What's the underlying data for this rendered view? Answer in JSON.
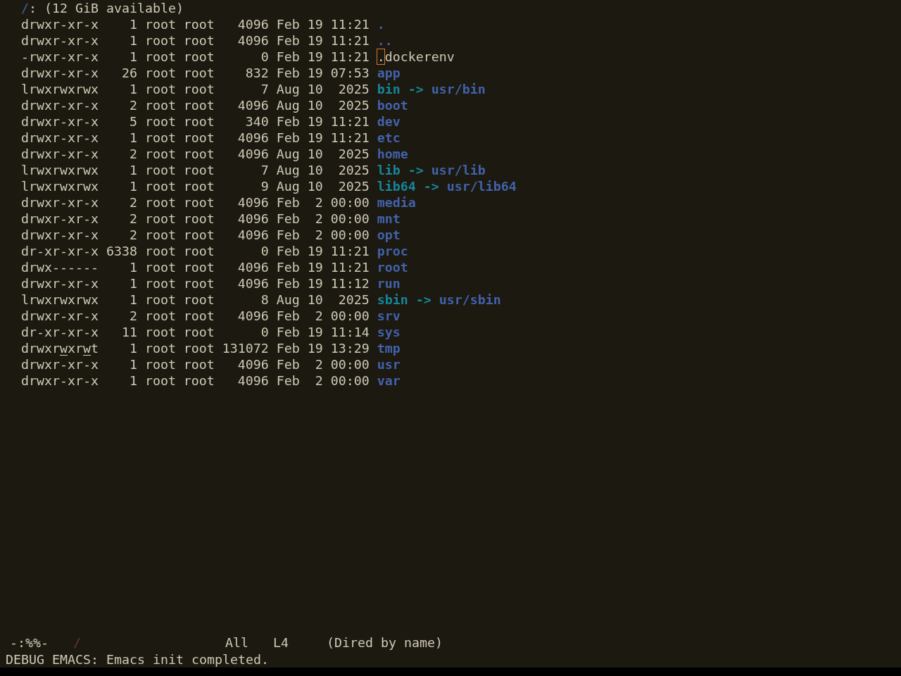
{
  "header": {
    "path": "/",
    "summary": ": (12 GiB available)"
  },
  "rows": [
    {
      "kind": "dir",
      "perms": "drwxr-xr-x",
      "world_writable": false,
      "links": "1",
      "owner": "root",
      "group": "root",
      "size": "4096",
      "date": "Feb 19 11:21",
      "name": ".",
      "cursor": false
    },
    {
      "kind": "dir",
      "perms": "drwxr-xr-x",
      "world_writable": false,
      "links": "1",
      "owner": "root",
      "group": "root",
      "size": "4096",
      "date": "Feb 19 11:21",
      "name": "..",
      "cursor": false
    },
    {
      "kind": "file",
      "perms": "-rwxr-xr-x",
      "world_writable": false,
      "links": "1",
      "owner": "root",
      "group": "root",
      "size": "0",
      "date": "Feb 19 11:21",
      "name": ".dockerenv",
      "cursor": true
    },
    {
      "kind": "dir",
      "perms": "drwxr-xr-x",
      "world_writable": false,
      "links": "26",
      "owner": "root",
      "group": "root",
      "size": "832",
      "date": "Feb 19 07:53",
      "name": "app",
      "cursor": false
    },
    {
      "kind": "symlink",
      "perms": "lrwxrwxrwx",
      "world_writable": false,
      "links": "1",
      "owner": "root",
      "group": "root",
      "size": "7",
      "date": "Aug 10  2025",
      "name": "bin",
      "arrow": "->",
      "target": "usr/bin",
      "cursor": false
    },
    {
      "kind": "dir",
      "perms": "drwxr-xr-x",
      "world_writable": false,
      "links": "2",
      "owner": "root",
      "group": "root",
      "size": "4096",
      "date": "Aug 10  2025",
      "name": "boot",
      "cursor": false
    },
    {
      "kind": "dir",
      "perms": "drwxr-xr-x",
      "world_writable": false,
      "links": "5",
      "owner": "root",
      "group": "root",
      "size": "340",
      "date": "Feb 19 11:21",
      "name": "dev",
      "cursor": false
    },
    {
      "kind": "dir",
      "perms": "drwxr-xr-x",
      "world_writable": false,
      "links": "1",
      "owner": "root",
      "group": "root",
      "size": "4096",
      "date": "Feb 19 11:21",
      "name": "etc",
      "cursor": false
    },
    {
      "kind": "dir",
      "perms": "drwxr-xr-x",
      "world_writable": false,
      "links": "2",
      "owner": "root",
      "group": "root",
      "size": "4096",
      "date": "Aug 10  2025",
      "name": "home",
      "cursor": false
    },
    {
      "kind": "symlink",
      "perms": "lrwxrwxrwx",
      "world_writable": false,
      "links": "1",
      "owner": "root",
      "group": "root",
      "size": "7",
      "date": "Aug 10  2025",
      "name": "lib",
      "arrow": "->",
      "target": "usr/lib",
      "cursor": false
    },
    {
      "kind": "symlink",
      "perms": "lrwxrwxrwx",
      "world_writable": false,
      "links": "1",
      "owner": "root",
      "group": "root",
      "size": "9",
      "date": "Aug 10  2025",
      "name": "lib64",
      "arrow": "->",
      "target": "usr/lib64",
      "cursor": false
    },
    {
      "kind": "dir",
      "perms": "drwxr-xr-x",
      "world_writable": false,
      "links": "2",
      "owner": "root",
      "group": "root",
      "size": "4096",
      "date": "Feb  2 00:00",
      "name": "media",
      "cursor": false
    },
    {
      "kind": "dir",
      "perms": "drwxr-xr-x",
      "world_writable": false,
      "links": "2",
      "owner": "root",
      "group": "root",
      "size": "4096",
      "date": "Feb  2 00:00",
      "name": "mnt",
      "cursor": false
    },
    {
      "kind": "dir",
      "perms": "drwxr-xr-x",
      "world_writable": false,
      "links": "2",
      "owner": "root",
      "group": "root",
      "size": "4096",
      "date": "Feb  2 00:00",
      "name": "opt",
      "cursor": false
    },
    {
      "kind": "dir",
      "perms": "dr-xr-xr-x",
      "world_writable": false,
      "links": "6338",
      "owner": "root",
      "group": "root",
      "size": "0",
      "date": "Feb 19 11:21",
      "name": "proc",
      "cursor": false
    },
    {
      "kind": "dir",
      "perms": "drwx------",
      "world_writable": false,
      "links": "1",
      "owner": "root",
      "group": "root",
      "size": "4096",
      "date": "Feb 19 11:21",
      "name": "root",
      "cursor": false
    },
    {
      "kind": "dir",
      "perms": "drwxr-xr-x",
      "world_writable": false,
      "links": "1",
      "owner": "root",
      "group": "root",
      "size": "4096",
      "date": "Feb 19 11:12",
      "name": "run",
      "cursor": false
    },
    {
      "kind": "symlink",
      "perms": "lrwxrwxrwx",
      "world_writable": false,
      "links": "1",
      "owner": "root",
      "group": "root",
      "size": "8",
      "date": "Aug 10  2025",
      "name": "sbin",
      "arrow": "->",
      "target": "usr/sbin",
      "cursor": false
    },
    {
      "kind": "dir",
      "perms": "drwxr-xr-x",
      "world_writable": false,
      "links": "2",
      "owner": "root",
      "group": "root",
      "size": "4096",
      "date": "Feb  2 00:00",
      "name": "srv",
      "cursor": false
    },
    {
      "kind": "dir",
      "perms": "dr-xr-xr-x",
      "world_writable": false,
      "links": "11",
      "owner": "root",
      "group": "root",
      "size": "0",
      "date": "Feb 19 11:14",
      "name": "sys",
      "cursor": false
    },
    {
      "kind": "dir",
      "perms": "drwxrwxrwt",
      "world_writable": true,
      "links": "1",
      "owner": "root",
      "group": "root",
      "size": "131072",
      "date": "Feb 19 13:29",
      "name": "tmp",
      "cursor": false
    },
    {
      "kind": "dir",
      "perms": "drwxr-xr-x",
      "world_writable": false,
      "links": "1",
      "owner": "root",
      "group": "root",
      "size": "4096",
      "date": "Feb  2 00:00",
      "name": "usr",
      "cursor": false
    },
    {
      "kind": "dir",
      "perms": "drwxr-xr-x",
      "world_writable": false,
      "links": "1",
      "owner": "root",
      "group": "root",
      "size": "4096",
      "date": "Feb  2 00:00",
      "name": "var",
      "cursor": false
    }
  ],
  "mode_line": {
    "status": "-:%%-",
    "buffer": "/",
    "position": "All",
    "line": "L4",
    "mode": "(Dired by name)"
  },
  "echo_area": "DEBUG EMACS: Emacs init completed."
}
